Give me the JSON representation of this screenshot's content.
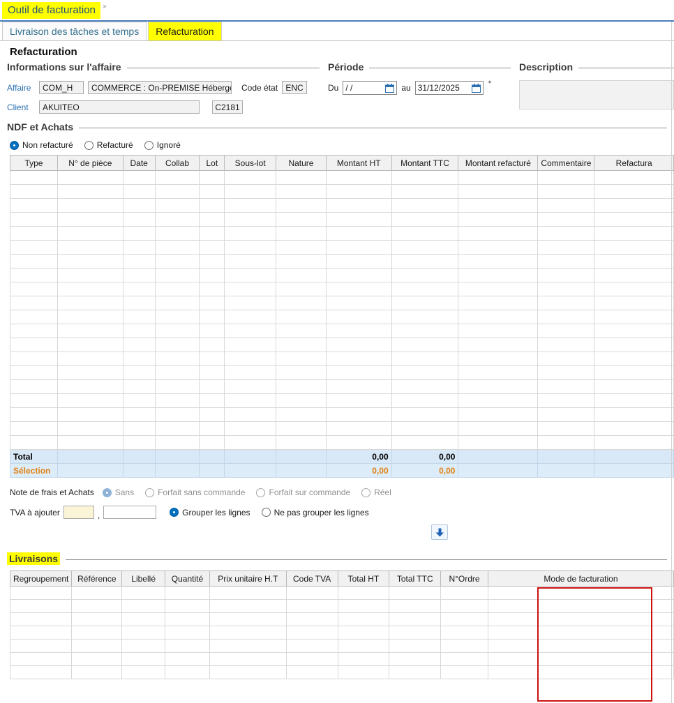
{
  "colors": {
    "highlight_yellow": "#ffff00",
    "accent_blue": "#0070c0",
    "tab_underline_blue": "#4b7fbc",
    "selection_orange": "#e08214",
    "annotation_red": "#cc1111",
    "total_row_blue": "#d9e8f6"
  },
  "window_tab": {
    "title": "Outil de facturation",
    "close": "×"
  },
  "tabs": [
    {
      "label": "Livraison des tâches et temps"
    },
    {
      "label": "Refacturation"
    }
  ],
  "page_title": "Refacturation",
  "affaire_section": {
    "title": "Informations sur l'affaire",
    "affaire_label": "Affaire",
    "affaire_code": "COM_H",
    "affaire_name": "COMMERCE : On-PREMISE Hébergé",
    "code_etat_label": "Code état",
    "code_etat": "ENC",
    "client_label": "Client",
    "client_name": "AKUITEO",
    "client_code": "C2181"
  },
  "periode_section": {
    "title": "Période",
    "du_label": "Du",
    "du_value": "/ /",
    "au_label": "au",
    "au_value": "31/12/2025",
    "required": "*"
  },
  "description_section": {
    "title": "Description",
    "value": ""
  },
  "ndf_section": {
    "title": "NDF et Achats",
    "filters": [
      {
        "label": "Non refacturé",
        "selected": true
      },
      {
        "label": "Refacturé",
        "selected": false
      },
      {
        "label": "Ignoré",
        "selected": false
      }
    ],
    "table": {
      "columns": [
        "Type",
        "N° de pièce",
        "Date",
        "Collab",
        "Lot",
        "Sous-lot",
        "Nature",
        "Montant HT",
        "Montant TTC",
        "Montant refacturé",
        "Commentaire",
        "Refactura"
      ],
      "empty_rows": 20,
      "total_row": {
        "label": "Total",
        "values": {
          "7": "0,00",
          "8": "0,00"
        }
      },
      "selection_row": {
        "label": "Sélection",
        "values": {
          "7": "0,00",
          "8": "0,00"
        }
      }
    },
    "note_frais": {
      "label": "Note de frais et Achats",
      "options": [
        {
          "label": "Sans",
          "selected": true,
          "disabled": true
        },
        {
          "label": "Forfait sans commande",
          "selected": false,
          "disabled": true
        },
        {
          "label": "Forfait sur commande",
          "selected": false,
          "disabled": true
        },
        {
          "label": "Réel",
          "selected": false,
          "disabled": true
        }
      ]
    },
    "tva": {
      "label": "TVA à ajouter",
      "value_int": "",
      "separator": ",",
      "value_dec": "",
      "options": [
        {
          "label": "Grouper les lignes",
          "selected": true
        },
        {
          "label": "Ne pas grouper les lignes",
          "selected": false
        }
      ]
    }
  },
  "livraisons_section": {
    "title": "Livraisons",
    "table": {
      "columns": [
        "Regroupement",
        "Référence",
        "Libellé",
        "Quantité",
        "Prix unitaire H.T",
        "Code TVA",
        "Total HT",
        "Total TTC",
        "N°Ordre",
        "Mode de facturation"
      ],
      "empty_rows": 7
    }
  }
}
